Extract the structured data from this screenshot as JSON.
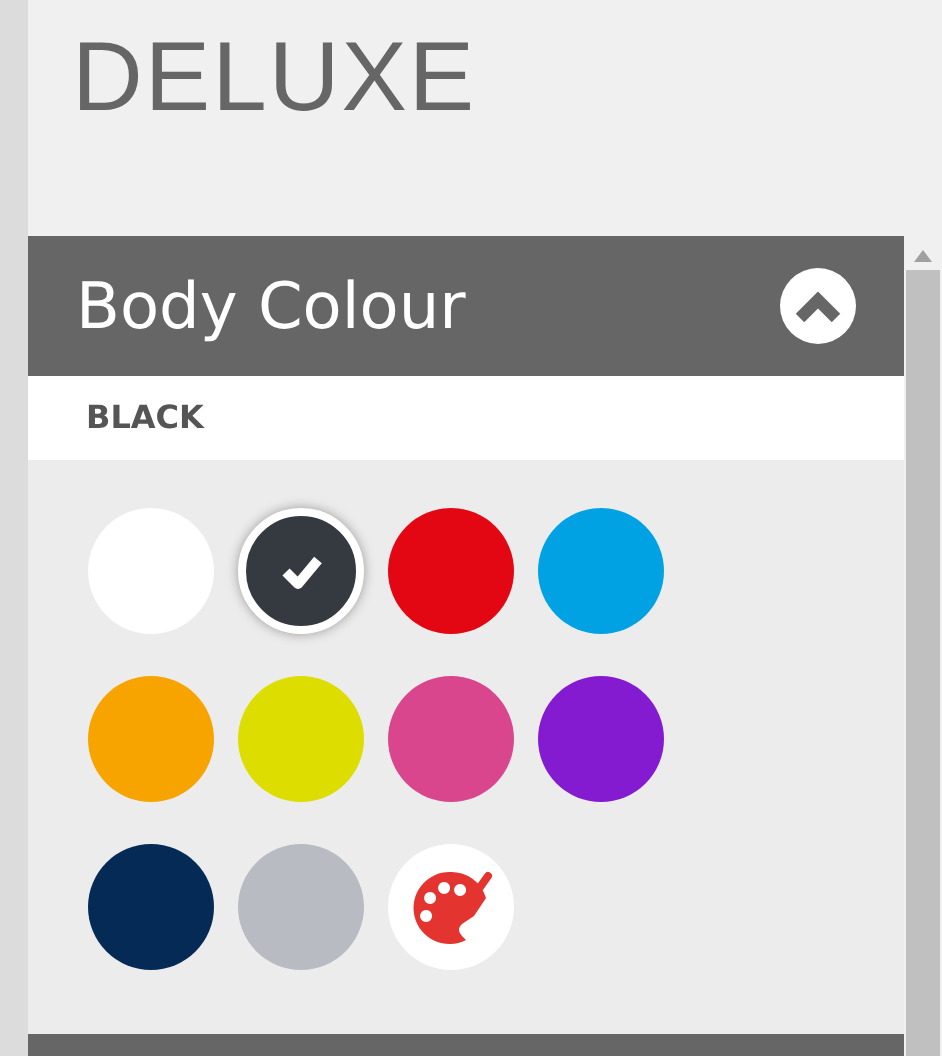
{
  "title": "DELUXE",
  "panel": {
    "title": "Body Colour",
    "expanded": true,
    "selected_label": "BLACK",
    "swatches": [
      {
        "kind": "color",
        "color": "#ffffff",
        "selected": false
      },
      {
        "kind": "color",
        "color": "#343a40",
        "selected": true
      },
      {
        "kind": "color",
        "color": "#e30613",
        "selected": false
      },
      {
        "kind": "color",
        "color": "#00a2e3",
        "selected": false
      },
      {
        "kind": "color",
        "color": "#f7a300",
        "selected": false
      },
      {
        "kind": "color",
        "color": "#dddd00",
        "selected": false
      },
      {
        "kind": "color",
        "color": "#d9468e",
        "selected": false
      },
      {
        "kind": "color",
        "color": "#851bd0",
        "selected": false
      },
      {
        "kind": "color",
        "color": "#062a56",
        "selected": false
      },
      {
        "kind": "color",
        "color": "#b8bcc2",
        "selected": false
      },
      {
        "kind": "custom",
        "selected": false
      }
    ]
  }
}
